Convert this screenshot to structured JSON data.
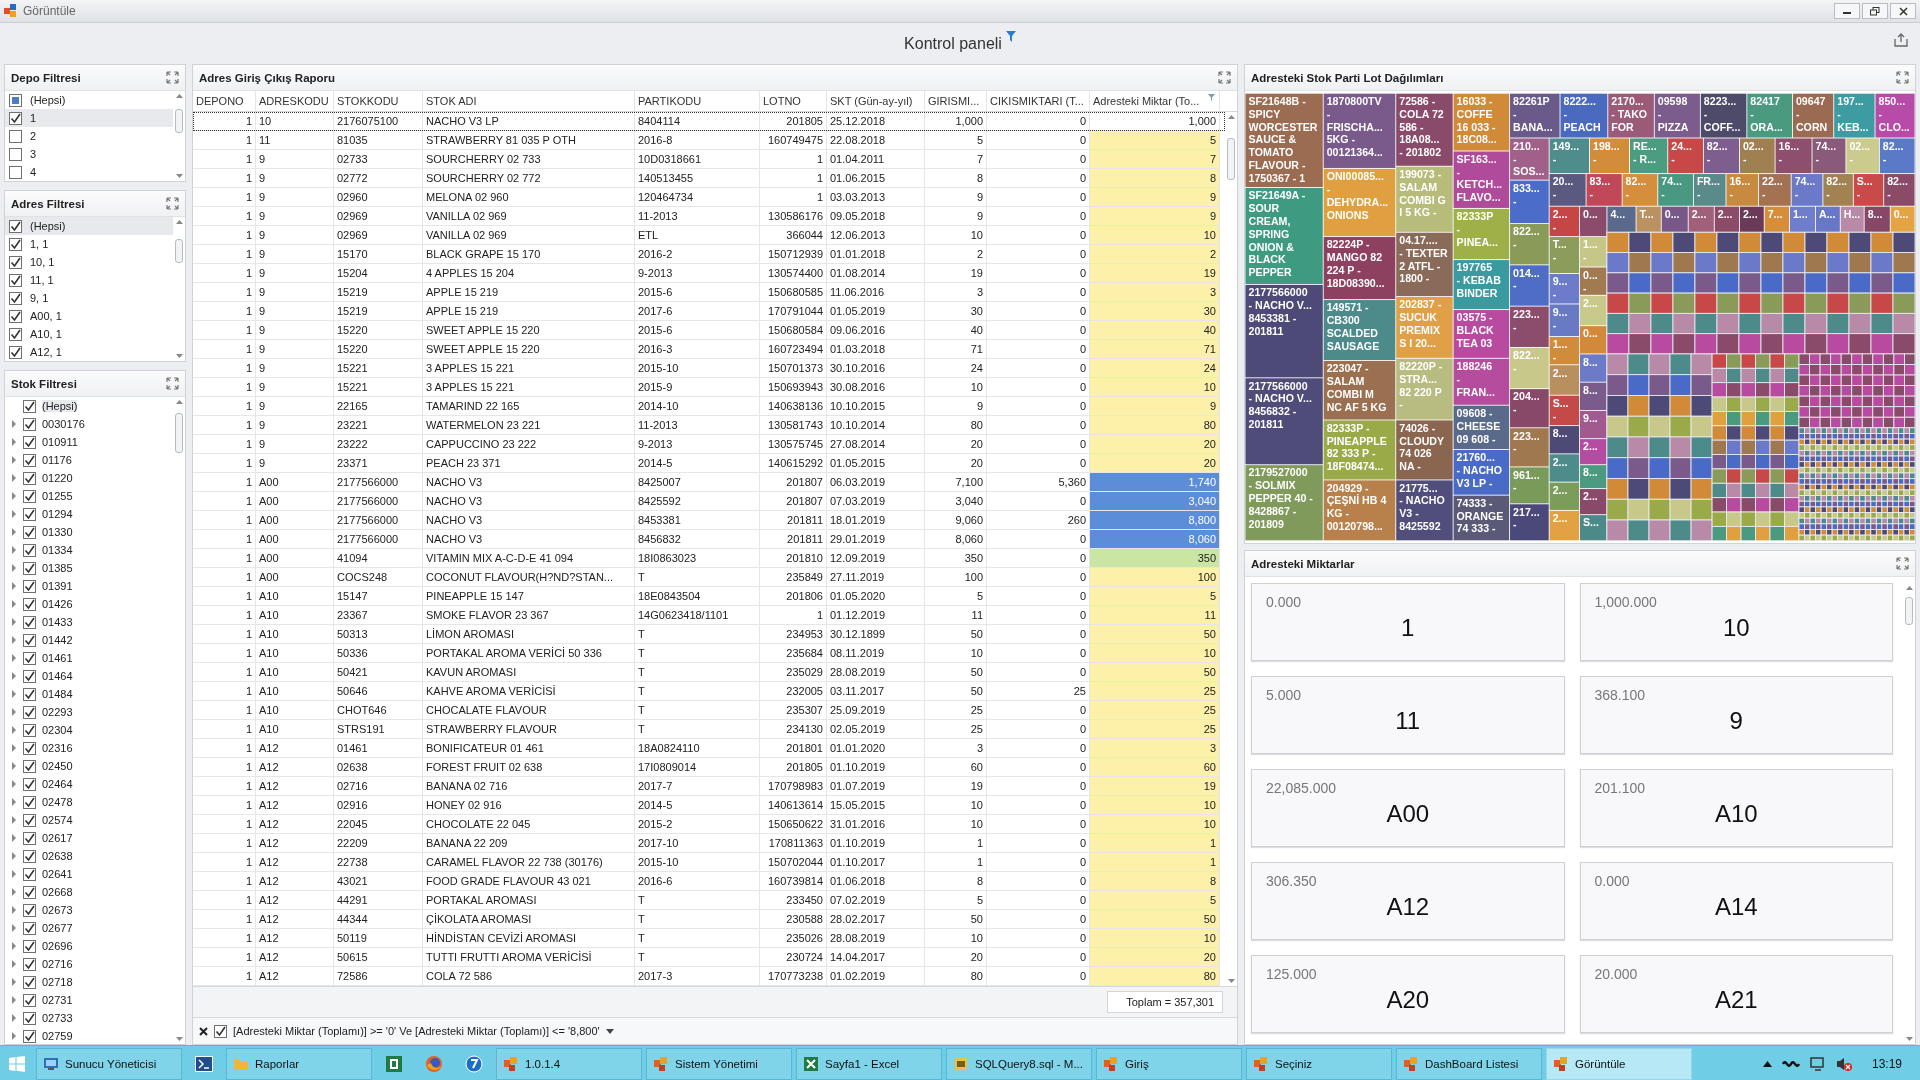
{
  "window": {
    "title": "Görüntüle"
  },
  "dashboard": {
    "title": "Kontrol paneli"
  },
  "depo_filter": {
    "title": "Depo Filtresi",
    "items": [
      {
        "label": "(Hepsi)",
        "checked": false,
        "partial": true,
        "selected": false
      },
      {
        "label": "1",
        "checked": true,
        "partial": false,
        "selected": true
      },
      {
        "label": "2",
        "checked": false,
        "partial": false,
        "selected": false
      },
      {
        "label": "3",
        "checked": false,
        "partial": false,
        "selected": false
      },
      {
        "label": "4",
        "checked": false,
        "partial": false,
        "selected": false
      }
    ]
  },
  "adres_filter": {
    "title": "Adres Filtresi",
    "items": [
      {
        "label": "(Hepsi)",
        "checked": true,
        "partial": false,
        "selected": true
      },
      {
        "label": "1, 1",
        "checked": true,
        "partial": false,
        "selected": false
      },
      {
        "label": "10, 1",
        "checked": true,
        "partial": false,
        "selected": false
      },
      {
        "label": "11, 1",
        "checked": true,
        "partial": false,
        "selected": false
      },
      {
        "label": "9, 1",
        "checked": true,
        "partial": false,
        "selected": false
      },
      {
        "label": "A00, 1",
        "checked": true,
        "partial": false,
        "selected": false
      },
      {
        "label": "A10, 1",
        "checked": true,
        "partial": false,
        "selected": false
      },
      {
        "label": "A12, 1",
        "checked": true,
        "partial": false,
        "selected": false
      }
    ]
  },
  "stok_filter": {
    "title": "Stok Filtresi",
    "root": {
      "label": "(Hepsi)",
      "checked": true,
      "selected": true
    },
    "items": [
      {
        "label": "0030176",
        "checked": true,
        "expanded": false
      },
      {
        "label": "010911",
        "checked": true,
        "expanded": false
      },
      {
        "label": "01176",
        "checked": true,
        "expanded": false
      },
      {
        "label": "01220",
        "checked": true,
        "expanded": false
      },
      {
        "label": "01255",
        "checked": true,
        "expanded": false
      },
      {
        "label": "01294",
        "checked": true,
        "expanded": false
      },
      {
        "label": "01330",
        "checked": true,
        "expanded": false
      },
      {
        "label": "01334",
        "checked": true,
        "expanded": false
      },
      {
        "label": "01385",
        "checked": true,
        "expanded": false
      },
      {
        "label": "01391",
        "checked": true,
        "expanded": false
      },
      {
        "label": "01426",
        "checked": true,
        "expanded": false
      },
      {
        "label": "01433",
        "checked": true,
        "expanded": false
      },
      {
        "label": "01442",
        "checked": true,
        "expanded": false
      },
      {
        "label": "01461",
        "checked": true,
        "expanded": false
      },
      {
        "label": "01464",
        "checked": true,
        "expanded": false
      },
      {
        "label": "01484",
        "checked": true,
        "expanded": false
      },
      {
        "label": "02293",
        "checked": true,
        "expanded": false
      },
      {
        "label": "02304",
        "checked": true,
        "expanded": false
      },
      {
        "label": "02316",
        "checked": true,
        "expanded": false
      },
      {
        "label": "02450",
        "checked": true,
        "expanded": false
      },
      {
        "label": "02464",
        "checked": true,
        "expanded": false
      },
      {
        "label": "02478",
        "checked": true,
        "expanded": false
      },
      {
        "label": "02574",
        "checked": true,
        "expanded": false
      },
      {
        "label": "02617",
        "checked": true,
        "expanded": false
      },
      {
        "label": "02638",
        "checked": true,
        "expanded": false
      },
      {
        "label": "02641",
        "checked": true,
        "expanded": false
      },
      {
        "label": "02668",
        "checked": true,
        "expanded": false
      },
      {
        "label": "02673",
        "checked": true,
        "expanded": false
      },
      {
        "label": "02677",
        "checked": true,
        "expanded": false
      },
      {
        "label": "02696",
        "checked": true,
        "expanded": false
      },
      {
        "label": "02716",
        "checked": true,
        "expanded": false
      },
      {
        "label": "02718",
        "checked": true,
        "expanded": false
      },
      {
        "label": "02731",
        "checked": true,
        "expanded": false
      },
      {
        "label": "02733",
        "checked": true,
        "expanded": false
      },
      {
        "label": "02759",
        "checked": true,
        "expanded": false
      }
    ]
  },
  "table": {
    "title": "Adres Giriş Çıkış Raporu",
    "columns": [
      "DEPONO",
      "ADRESKODU",
      "STOKKODU",
      "STOK ADI",
      "PARTIKODU",
      "LOTNO",
      "SKT (Gün-ay-yıl)",
      "GIRISMI...",
      "CIKISMIKTARI (T...",
      "Adresteki Miktar (To..."
    ],
    "rows": [
      {
        "cells": [
          "1",
          "10",
          "2176075100",
          "NACHO V3 LP",
          "8404114",
          "201805",
          "25.12.2018",
          "1,000",
          "0",
          "1,000"
        ],
        "selected": true
      },
      {
        "cells": [
          "1",
          "11",
          "81035",
          "STRAWBERRY 81 035 P OTH",
          "2016-8",
          "160749475",
          "22.08.2018",
          "5",
          "0",
          "5"
        ],
        "color": "#fdf1a9",
        "selected": false
      },
      {
        "cells": [
          "1",
          "9",
          "02733",
          "SOURCHERRY 02 733",
          "10D0318661",
          "1",
          "01.04.2011",
          "7",
          "0",
          "7"
        ],
        "color": "#fdf1a9",
        "selected": false
      },
      {
        "cells": [
          "1",
          "9",
          "02772",
          "SOURCHERRY 02 772",
          "140513455",
          "1",
          "01.06.2015",
          "8",
          "0",
          "8"
        ],
        "color": "#fdf1a9",
        "selected": false
      },
      {
        "cells": [
          "1",
          "9",
          "02960",
          "MELONA 02 960",
          "120464734",
          "1",
          "03.03.2013",
          "9",
          "0",
          "9"
        ],
        "color": "#fdf1a9",
        "selected": false
      },
      {
        "cells": [
          "1",
          "9",
          "02969",
          "VANILLA 02 969",
          "11-2013",
          "130586176",
          "09.05.2018",
          "9",
          "0",
          "9"
        ],
        "color": "#fdf1a9",
        "selected": false
      },
      {
        "cells": [
          "1",
          "9",
          "02969",
          "VANILLA 02 969",
          "ETL",
          "366044",
          "12.06.2013",
          "10",
          "0",
          "10"
        ],
        "color": "#fdf1a9",
        "selected": false
      },
      {
        "cells": [
          "1",
          "9",
          "15170",
          "BLACK GRAPE 15 170",
          "2016-2",
          "150712939",
          "01.01.2018",
          "2",
          "0",
          "2"
        ],
        "color": "#fdf1a9",
        "selected": false
      },
      {
        "cells": [
          "1",
          "9",
          "15204",
          "4 APPLES 15 204",
          "9-2013",
          "130574400",
          "01.08.2014",
          "19",
          "0",
          "19"
        ],
        "color": "#fdf1a9",
        "selected": false
      },
      {
        "cells": [
          "1",
          "9",
          "15219",
          "APPLE 15 219",
          "2015-6",
          "150680585",
          "11.06.2016",
          "3",
          "0",
          "3"
        ],
        "color": "#fdf1a9",
        "selected": false
      },
      {
        "cells": [
          "1",
          "9",
          "15219",
          "APPLE 15 219",
          "2017-6",
          "170791044",
          "01.05.2019",
          "30",
          "0",
          "30"
        ],
        "color": "#fdf1a9",
        "selected": false
      },
      {
        "cells": [
          "1",
          "9",
          "15220",
          "SWEET APPLE 15 220",
          "2015-6",
          "150680584",
          "09.06.2016",
          "40",
          "0",
          "40"
        ],
        "color": "#fdf1a9",
        "selected": false
      },
      {
        "cells": [
          "1",
          "9",
          "15220",
          "SWEET APPLE 15 220",
          "2016-3",
          "160723494",
          "01.03.2018",
          "71",
          "0",
          "71"
        ],
        "color": "#fdf1a9",
        "selected": false
      },
      {
        "cells": [
          "1",
          "9",
          "15221",
          "3 APPLES 15 221",
          "2015-10",
          "150701373",
          "30.10.2016",
          "24",
          "0",
          "24"
        ],
        "color": "#fdf1a9",
        "selected": false
      },
      {
        "cells": [
          "1",
          "9",
          "15221",
          "3 APPLES 15 221",
          "2015-9",
          "150693943",
          "30.08.2016",
          "10",
          "0",
          "10"
        ],
        "color": "#fdf1a9",
        "selected": false
      },
      {
        "cells": [
          "1",
          "9",
          "22165",
          "TAMARIND 22 165",
          "2014-10",
          "140638136",
          "10.10.2015",
          "9",
          "0",
          "9"
        ],
        "color": "#fdf1a9",
        "selected": false
      },
      {
        "cells": [
          "1",
          "9",
          "23221",
          "WATERMELON 23 221",
          "11-2013",
          "130581743",
          "10.10.2014",
          "80",
          "0",
          "80"
        ],
        "color": "#fdf1a9",
        "selected": false
      },
      {
        "cells": [
          "1",
          "9",
          "23222",
          "CAPPUCCINO 23 222",
          "9-2013",
          "130575745",
          "27.08.2014",
          "20",
          "0",
          "20"
        ],
        "color": "#fdf1a9",
        "selected": false
      },
      {
        "cells": [
          "1",
          "9",
          "23371",
          "PEACH 23 371",
          "2014-5",
          "140615292",
          "01.05.2015",
          "20",
          "0",
          "20"
        ],
        "color": "#fdf1a9",
        "selected": false
      },
      {
        "cells": [
          "1",
          "A00",
          "2177566000",
          "NACHO V3",
          "8425007",
          "201807",
          "06.03.2019",
          "7,100",
          "5,360",
          "1,740"
        ],
        "color": "#5b8dd8",
        "selected": false
      },
      {
        "cells": [
          "1",
          "A00",
          "2177566000",
          "NACHO V3",
          "8425592",
          "201807",
          "07.03.2019",
          "3,040",
          "0",
          "3,040"
        ],
        "color": "#5b8dd8",
        "selected": false
      },
      {
        "cells": [
          "1",
          "A00",
          "2177566000",
          "NACHO V3",
          "8453381",
          "201811",
          "18.01.2019",
          "9,060",
          "260",
          "8,800"
        ],
        "color": "#5b8dd8",
        "selected": false
      },
      {
        "cells": [
          "1",
          "A00",
          "2177566000",
          "NACHO V3",
          "8456832",
          "201811",
          "29.01.2019",
          "8,060",
          "0",
          "8,060"
        ],
        "color": "#5b8dd8",
        "selected": false
      },
      {
        "cells": [
          "1",
          "A00",
          "41094",
          "VITAMIN MIX A-C-D-E 41 094",
          "18I0863023",
          "201810",
          "12.09.2019",
          "350",
          "0",
          "350"
        ],
        "color": "#c9e7a2",
        "selected": false
      },
      {
        "cells": [
          "1",
          "A00",
          "COCS248",
          "COCONUT FLAVOUR(H?ND?STAN...",
          "T",
          "235849",
          "27.11.2019",
          "100",
          "0",
          "100"
        ],
        "color": "#fdf1a9",
        "selected": false
      },
      {
        "cells": [
          "1",
          "A10",
          "15147",
          "PINEAPPLE 15 147",
          "18E0843504",
          "201806",
          "01.05.2020",
          "5",
          "0",
          "5"
        ],
        "color": "#fdf1a9",
        "selected": false
      },
      {
        "cells": [
          "1",
          "A10",
          "23367",
          "SMOKE FLAVOR 23 367",
          "14G0623418/1101",
          "1",
          "01.12.2019",
          "11",
          "0",
          "11"
        ],
        "color": "#fdf1a9",
        "selected": false
      },
      {
        "cells": [
          "1",
          "A10",
          "50313",
          "LİMON AROMASI",
          "T",
          "234953",
          "30.12.1899",
          "50",
          "0",
          "50"
        ],
        "color": "#fdf1a9",
        "selected": false
      },
      {
        "cells": [
          "1",
          "A10",
          "50336",
          "PORTAKAL AROMA VERİCİ 50 336",
          "T",
          "235684",
          "08.11.2019",
          "10",
          "0",
          "10"
        ],
        "color": "#fdf1a9",
        "selected": false
      },
      {
        "cells": [
          "1",
          "A10",
          "50421",
          "KAVUN AROMASI",
          "T",
          "235029",
          "28.08.2019",
          "50",
          "0",
          "50"
        ],
        "color": "#fdf1a9",
        "selected": false
      },
      {
        "cells": [
          "1",
          "A10",
          "50646",
          "KAHVE AROMA VERİCİSİ",
          "T",
          "232005",
          "03.11.2017",
          "50",
          "25",
          "25"
        ],
        "color": "#fdf1a9",
        "selected": false
      },
      {
        "cells": [
          "1",
          "A10",
          "CHOT646",
          "CHOCALATE FLAVOUR",
          "T",
          "235307",
          "25.09.2019",
          "25",
          "0",
          "25"
        ],
        "color": "#fdf1a9",
        "selected": false
      },
      {
        "cells": [
          "1",
          "A10",
          "STRS191",
          "STRAWBERRY FLAVOUR",
          "T",
          "234130",
          "02.05.2019",
          "25",
          "0",
          "25"
        ],
        "color": "#fdf1a9",
        "selected": false
      },
      {
        "cells": [
          "1",
          "A12",
          "01461",
          "BONIFICATEUR 01 461",
          "18A0824110",
          "201801",
          "01.01.2020",
          "3",
          "0",
          "3"
        ],
        "color": "#fdf1a9",
        "selected": false
      },
      {
        "cells": [
          "1",
          "A12",
          "02638",
          "FOREST FRUIT 02 638",
          "17I0809014",
          "201805",
          "01.10.2019",
          "60",
          "0",
          "60"
        ],
        "color": "#fdf1a9",
        "selected": false
      },
      {
        "cells": [
          "1",
          "A12",
          "02716",
          "BANANA 02 716",
          "2017-7",
          "170798983",
          "01.07.2019",
          "19",
          "0",
          "19"
        ],
        "color": "#fdf1a9",
        "selected": false
      },
      {
        "cells": [
          "1",
          "A12",
          "02916",
          "HONEY 02 916",
          "2014-5",
          "140613614",
          "15.05.2015",
          "10",
          "0",
          "10"
        ],
        "color": "#fdf1a9",
        "selected": false
      },
      {
        "cells": [
          "1",
          "A12",
          "22045",
          "CHOCOLATE 22 045",
          "2015-2",
          "150650622",
          "31.01.2016",
          "10",
          "0",
          "10"
        ],
        "color": "#fdf1a9",
        "selected": false
      },
      {
        "cells": [
          "1",
          "A12",
          "22209",
          "BANANA 22 209",
          "2017-10",
          "170811363",
          "01.10.2019",
          "1",
          "0",
          "1"
        ],
        "color": "#fdf1a9",
        "selected": false
      },
      {
        "cells": [
          "1",
          "A12",
          "22738",
          "CARAMEL FLAVOR 22 738 (30176)",
          "2015-10",
          "150702044",
          "01.10.2017",
          "1",
          "0",
          "1"
        ],
        "color": "#fdf1a9",
        "selected": false
      },
      {
        "cells": [
          "1",
          "A12",
          "43021",
          "FOOD GRADE FLAVOUR 43 021",
          "2016-6",
          "160739814",
          "01.06.2018",
          "8",
          "0",
          "8"
        ],
        "color": "#fdf1a9",
        "selected": false
      },
      {
        "cells": [
          "1",
          "A12",
          "44291",
          "PORTAKAL AROMASI",
          "T",
          "233450",
          "07.02.2019",
          "5",
          "0",
          "5"
        ],
        "color": "#fdf1a9",
        "selected": false
      },
      {
        "cells": [
          "1",
          "A12",
          "44344",
          "ÇİKOLATA AROMASI",
          "T",
          "230588",
          "28.02.2017",
          "50",
          "0",
          "50"
        ],
        "color": "#fdf1a9",
        "selected": false
      },
      {
        "cells": [
          "1",
          "A12",
          "50119",
          "HİNDİSTAN CEVİZİ AROMASI",
          "T",
          "235026",
          "28.08.2019",
          "10",
          "0",
          "10"
        ],
        "color": "#fdf1a9",
        "selected": false
      },
      {
        "cells": [
          "1",
          "A12",
          "50615",
          "TUTTI FRUTTI AROMA VERİCİSİ",
          "T",
          "230724",
          "14.04.2017",
          "20",
          "0",
          "20"
        ],
        "color": "#fdf1a9",
        "selected": false
      },
      {
        "cells": [
          "1",
          "A12",
          "72586",
          "COLA 72 586",
          "2017-3",
          "170773238",
          "01.02.2019",
          "80",
          "0",
          "80"
        ],
        "color": "#fdf1a9",
        "selected": false
      }
    ],
    "total": "Toplam = 357,301",
    "filter": {
      "enabled": true,
      "text": "[Adresteki Miktar (Toplamı)] >= '0' Ve [Adresteki Miktar (Toplamı)] <= '8,800'"
    }
  },
  "treemap": {
    "title": "Adresteki Stok Parti Lot Dağılımları",
    "tiles": [
      {
        "label": "SF21648B -\nSPICY\nWORCESTER\nSAUCE &\nTOMATO\nFLAVOUR -\n1750367 - 1",
        "color": "#9b6b52"
      },
      {
        "label": "SF21649A -\nSOUR\nCREAM,\nSPRING\nONION &\nBLACK\nPEPPER",
        "color": "#3f9a82"
      },
      {
        "label": "2177566000\n- NACHO V...\n8453381 -\n201811",
        "color": "#4d4a78"
      },
      {
        "label": "2177566000\n- NACHO V...\n8456832 -\n201811",
        "color": "#4f4c7a"
      },
      {
        "label": "2179527000\n- SOLMIX\nPEPPER 40 -\n8428867 -\n201809",
        "color": "#7f9a5a"
      },
      {
        "label": "1870800TV\n-\nFRISCHA...\n5KG -\n00121364...",
        "color": "#7a5a8a"
      },
      {
        "label": "ONI00085...\n-\nDEHYDRA...\nONIONS",
        "color": "#e0a040"
      },
      {
        "label": "82224P -\nMANGO 82\n224 P -\n18D08390...",
        "color": "#8e4060"
      },
      {
        "label": "149571 -\nCB300\nSCALDED\nSAUSAGE",
        "color": "#4d8a8a"
      },
      {
        "label": "223047 -\nSALAM\nCOMBI M\nNC AF 5 KG",
        "color": "#9a7050"
      },
      {
        "label": "82333P -\nPINEAPPLE\n82 333 P -\n18F08474...",
        "color": "#9aaa48"
      },
      {
        "label": "204929 -\nÇEŞNİ HB 4\nKG -\n00120798...",
        "color": "#b8804a"
      },
      {
        "label": "72586 -\nCOLA 72\n586 -\n18A08...\n- 201802",
        "color": "#8a4a6a"
      },
      {
        "label": "199073 -\nSALAM\nCOMBI G\nI 5 KG -",
        "color": "#b8bc7a"
      },
      {
        "label": "04.17....\n- TEXTER\n2 ATFL -\n1800 -",
        "color": "#8a6a58"
      },
      {
        "label": "202837 -\nSUCUK\nPREMIX\nS I 20...",
        "color": "#e0a048"
      },
      {
        "label": "82220P -\nSTRA...\n82 220 P\n-",
        "color": "#b8bc80"
      },
      {
        "label": "74026 -\nCLOUDY\n74 026\nNA -",
        "color": "#8a6550"
      },
      {
        "label": "21775...\n- NACHO\nV3 -\n8425592",
        "color": "#514e7c"
      },
      {
        "label": "16033 -\nCOFFE\n16 033 -\n18C08...",
        "color": "#d08a38"
      },
      {
        "label": "SF163...\n-\nKETCH...\nFLAVO...",
        "color": "#b04a9a"
      },
      {
        "label": "82333P\n-\nPINEA...",
        "color": "#a0b048"
      },
      {
        "label": "197765\n- KEBAB\nBINDER",
        "color": "#3a9aa0"
      },
      {
        "label": "03575 -\nBLACK\nTEA 03",
        "color": "#b84aa0"
      },
      {
        "label": "188246\n-\nFRAN...",
        "color": "#b54c9e"
      },
      {
        "label": "09608 -\nCHEESE\n09 608 -",
        "color": "#5a6a8a"
      },
      {
        "label": "21760...\n- NACHO\nV3 LP -",
        "color": "#4a6ac8"
      },
      {
        "label": "74333 -\nORANGE\n74 333 -",
        "color": "#5a5a78"
      },
      {
        "label": "82261P\n-\nBANA...",
        "color": "#6a5a8a"
      },
      {
        "label": "8222...\n-\nPEACH",
        "color": "#4a6ac0"
      },
      {
        "label": "2170...\n- TAKO\nFOR",
        "color": "#9a5a78"
      },
      {
        "label": "09598\n-\nPIZZA",
        "color": "#7c5c8c"
      },
      {
        "label": "8223...\n-\nCOFF...",
        "color": "#4d4a6a"
      },
      {
        "label": "82417\n-\nORA...",
        "color": "#4a9a80"
      },
      {
        "label": "09647\n-\nCORN",
        "color": "#9a6a52"
      },
      {
        "label": "197...\n-\nKEB...",
        "color": "#3c9ca2"
      },
      {
        "label": "850...\n-\nCLO...",
        "color": "#b84aa8"
      },
      {
        "label": "210...\n-\nSOS...",
        "color": "#a0608a"
      },
      {
        "label": "833...\n-",
        "color": "#4c6cca"
      },
      {
        "label": "822...\n-",
        "color": "#8a9a58"
      },
      {
        "label": "014...\n-",
        "color": "#4e6ec6"
      },
      {
        "label": "223...\n-",
        "color": "#8c4c6c"
      },
      {
        "label": "822...\n-",
        "color": "#c8c88a"
      },
      {
        "label": "204...\n-",
        "color": "#884868"
      },
      {
        "label": "223...\n-",
        "color": "#a07850"
      },
      {
        "label": "961...\n-",
        "color": "#7a9a5a"
      },
      {
        "label": "217...\n-",
        "color": "#4b487a"
      },
      {
        "label": "149...\n-",
        "color": "#4f8c8c"
      },
      {
        "label": "198...\n-",
        "color": "#d28c3a"
      },
      {
        "label": "RE...\n- R...",
        "color": "#4c9c82"
      },
      {
        "label": "24...\n-",
        "color": "#c84848"
      },
      {
        "label": "82...\n-",
        "color": "#7e5e8e"
      },
      {
        "label": "02...\n-",
        "color": "#a08050"
      },
      {
        "label": "16...\n-",
        "color": "#8e4e6e"
      },
      {
        "label": "74...\n-",
        "color": "#8a5a7a"
      },
      {
        "label": "02...\n-",
        "color": "#cacb8c"
      },
      {
        "label": "82...\n-",
        "color": "#5a7ac8"
      },
      {
        "label": "20...\n-",
        "color": "#5a5a80"
      },
      {
        "label": "83...\n-",
        "color": "#c04858"
      },
      {
        "label": "82...\n-",
        "color": "#d48e3c"
      },
      {
        "label": "74...\n-",
        "color": "#489882"
      },
      {
        "label": "FR...\n-",
        "color": "#5a8a8a"
      },
      {
        "label": "16...\n-",
        "color": "#c88a40"
      },
      {
        "label": "22...\n-",
        "color": "#a27252"
      },
      {
        "label": "74...\n-",
        "color": "#6a7ac8"
      },
      {
        "label": "82...\n-",
        "color": "#a28252"
      },
      {
        "label": "S...\n-",
        "color": "#ca4a4a"
      },
      {
        "label": "82...\n-",
        "color": "#8a4a68"
      },
      {
        "label": "2...\n-",
        "color": "#c64646"
      },
      {
        "label": "T...\n-",
        "color": "#8c9c5a"
      },
      {
        "label": "9...\n-",
        "color": "#6c7cca"
      },
      {
        "label": "9...\n-",
        "color": "#687ac4"
      },
      {
        "label": "1...\n-",
        "color": "#d08c3a"
      },
      {
        "label": "2...",
        "color": "#b89060"
      },
      {
        "label": "S...\n-",
        "color": "#c44a4a"
      },
      {
        "label": "8...",
        "color": "#4d4a76"
      },
      {
        "label": "2...",
        "color": "#4e8b8b"
      },
      {
        "label": "2...",
        "color": "#7c9c5c"
      },
      {
        "label": "2...",
        "color": "#e2a242"
      },
      {
        "label": "0...",
        "color": "#8b4b6b"
      },
      {
        "label": "1...\n-",
        "color": "#c6c688"
      },
      {
        "label": "0...\n-",
        "color": "#a27a52"
      },
      {
        "label": "2...",
        "color": "#c9c98b"
      },
      {
        "label": "0...",
        "color": "#d28a3a"
      },
      {
        "label": "8...",
        "color": "#6b7bc9"
      },
      {
        "label": "8...",
        "color": "#7b5b8b"
      },
      {
        "label": "9...",
        "color": "#a05a90"
      },
      {
        "label": "2...",
        "color": "#b64ca2"
      },
      {
        "label": "8...",
        "color": "#4b9b81"
      },
      {
        "label": "2...",
        "color": "#894969"
      },
      {
        "label": "S...",
        "color": "#4c8989"
      },
      {
        "label": "4...",
        "color": "#5a6a8c"
      },
      {
        "label": "T...",
        "color": "#ba9262"
      },
      {
        "label": "0...",
        "color": "#785888"
      },
      {
        "label": "2...",
        "color": "#a0607a"
      },
      {
        "label": "2...",
        "color": "#8b4b69"
      },
      {
        "label": "2...",
        "color": "#6a3a58"
      },
      {
        "label": "7...",
        "color": "#d68e3a"
      },
      {
        "label": "1...",
        "color": "#6e7ecc"
      },
      {
        "label": "A...",
        "color": "#6878c6"
      },
      {
        "label": "H...",
        "color": "#b88aa8"
      },
      {
        "label": "8...",
        "color": "#874767"
      },
      {
        "label": "0...",
        "color": "#e4a444"
      }
    ]
  },
  "amounts": {
    "title": "Adresteki Miktarlar",
    "cards": [
      {
        "value": "0.000",
        "label": "1"
      },
      {
        "value": "1,000.000",
        "label": "10"
      },
      {
        "value": "5.000",
        "label": "11"
      },
      {
        "value": "368.100",
        "label": "9"
      },
      {
        "value": "22,085.000",
        "label": "A00"
      },
      {
        "value": "201.100",
        "label": "A10"
      },
      {
        "value": "306.350",
        "label": "A12"
      },
      {
        "value": "0.000",
        "label": "A14"
      },
      {
        "value": "125.000",
        "label": "A20"
      },
      {
        "value": "20.000",
        "label": "A21"
      }
    ]
  },
  "taskbar": {
    "items": [
      {
        "kind": "window",
        "label": "Sunucu Yöneticisi",
        "selected": false
      },
      {
        "kind": "pinned"
      },
      {
        "kind": "window",
        "label": "Raporlar",
        "selected": false
      },
      {
        "kind": "pinned"
      },
      {
        "kind": "pinned"
      },
      {
        "kind": "pinned"
      },
      {
        "kind": "window",
        "label": "1.0.1.4",
        "selected": false
      },
      {
        "kind": "window",
        "label": "Sistem Yönetimi",
        "selected": false
      },
      {
        "kind": "window",
        "label": "Sayfa1 - Excel",
        "selected": false
      },
      {
        "kind": "window",
        "label": "SQLQuery8.sql - M...",
        "selected": false
      },
      {
        "kind": "window",
        "label": "Giriş",
        "selected": false
      },
      {
        "kind": "window",
        "label": "Seçiniz",
        "selected": false
      },
      {
        "kind": "window",
        "label": "DashBoard Listesi",
        "selected": false
      },
      {
        "kind": "window",
        "label": "Görüntüle",
        "selected": true
      }
    ],
    "clock": "13:19"
  }
}
